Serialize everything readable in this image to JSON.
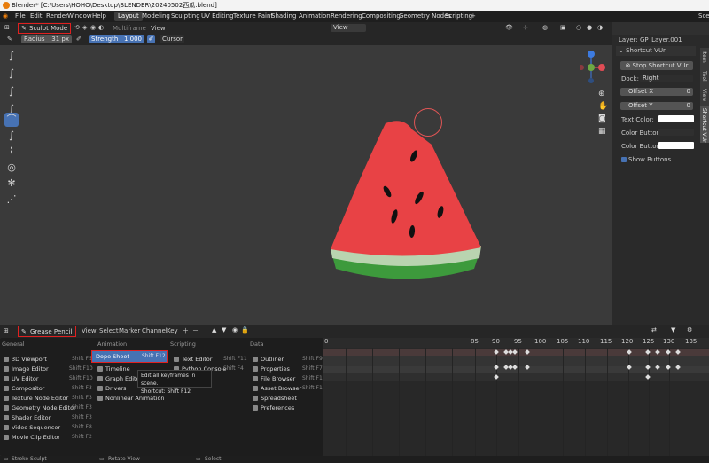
{
  "titlebar": {
    "title": "Blender* [C:\\Users\\HOHO\\Desktop\\BLENDER\\20240502西瓜.blend]"
  },
  "menu": [
    "File",
    "Edit",
    "Render",
    "Window",
    "Help"
  ],
  "workspaces": [
    "Layout",
    "Modeling",
    "Sculpting",
    "UV Editing",
    "Texture Paint",
    "Shading",
    "Animation",
    "Rendering",
    "Compositing",
    "Geometry Nodes",
    "Scripting"
  ],
  "scene_partial": "Sce",
  "header": {
    "mode": "Sculpt Mode",
    "multiframe": "Multiframe",
    "view": "View",
    "view_dropdown": "View"
  },
  "toolsettings": {
    "radius_label": "Radius",
    "radius_value": "31 px",
    "strength_label": "Strength",
    "strength_value": "1.000",
    "cursor": "Cursor"
  },
  "npanel": {
    "layer_label": "Layer:",
    "layer_value": "GP_Layer.001",
    "section": "Shortcut VUr",
    "stop_button": "Stop Shortcut VUr",
    "dock_label": "Dock:",
    "dock_value": "Right",
    "offset_x_label": "Offset X",
    "offset_x_value": "0",
    "offset_y_label": "Offset Y",
    "offset_y_value": "0",
    "text_color": "Text Color:",
    "color_buttons": "Color Buttons:",
    "color_buttons_a": "Color Buttons a...",
    "show_buttons": "Show Buttons",
    "tabs": [
      "Item",
      "Tool",
      "View",
      "Shortcut VUr"
    ]
  },
  "timeline_header": {
    "editor": "Grease Pencil",
    "items": [
      "View",
      "Select",
      "Marker",
      "Channel",
      "Key"
    ]
  },
  "frames": [
    "0",
    "85",
    "90",
    "95",
    "100",
    "105",
    "110",
    "115",
    "120",
    "125",
    "130",
    "135"
  ],
  "editor_menu": {
    "columns": [
      {
        "header": "General",
        "items": [
          {
            "label": "3D Viewport",
            "shortcut": "Shift F5"
          },
          {
            "label": "Image Editor",
            "shortcut": "Shift F10"
          },
          {
            "label": "UV Editor",
            "shortcut": "Shift F10"
          },
          {
            "label": "Compositor",
            "shortcut": "Shift F3"
          },
          {
            "label": "Texture Node Editor",
            "shortcut": "Shift F3"
          },
          {
            "label": "Geometry Node Editor",
            "shortcut": "Shift F3"
          },
          {
            "label": "Shader Editor",
            "shortcut": "Shift F3"
          },
          {
            "label": "Video Sequencer",
            "shortcut": "Shift F8"
          },
          {
            "label": "Movie Clip Editor",
            "shortcut": "Shift F2"
          }
        ]
      },
      {
        "header": "Animation",
        "items": [
          {
            "label": "Dope Sheet",
            "shortcut": "Shift F12"
          },
          {
            "label": "Timeline",
            "shortcut": ""
          },
          {
            "label": "Graph Editor",
            "shortcut": ""
          },
          {
            "label": "Drivers",
            "shortcut": ""
          },
          {
            "label": "Nonlinear Animation",
            "shortcut": ""
          }
        ]
      },
      {
        "header": "Scripting",
        "items": [
          {
            "label": "Text Editor",
            "shortcut": "Shift F11"
          },
          {
            "label": "Python Console",
            "shortcut": "Shift F4"
          }
        ]
      },
      {
        "header": "Data",
        "items": [
          {
            "label": "Outliner",
            "shortcut": "Shift F9"
          },
          {
            "label": "Properties",
            "shortcut": "Shift F7"
          },
          {
            "label": "File Browser",
            "shortcut": "Shift F1"
          },
          {
            "label": "Asset Browser",
            "shortcut": "Shift F1"
          },
          {
            "label": "Spreadsheet",
            "shortcut": ""
          },
          {
            "label": "Preferences",
            "shortcut": ""
          }
        ]
      }
    ]
  },
  "tooltip": {
    "line1": "Edit all keyframes in scene.",
    "line2": "Shortcut: Shift F12"
  },
  "status": {
    "left": "Stroke Sculpt",
    "middle": "Rotate View",
    "right": "Select"
  }
}
